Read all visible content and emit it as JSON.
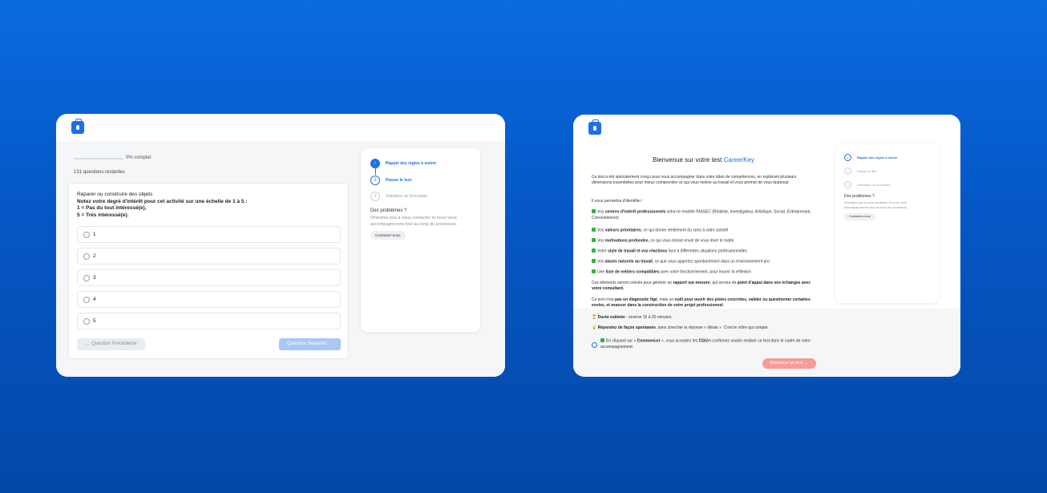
{
  "left": {
    "progress_label": "0% complet",
    "remaining": "131 questions restantes",
    "question": {
      "title": "Réparer ou construire des objets",
      "instruction": "Notez votre degré d'intérêt pour cet activité sur une échelle de 1 à 5 :",
      "scale_low": "1 = Pas du tout intéressé(e),",
      "scale_high": "5 = Très intéressé(e).",
      "options": [
        "1",
        "2",
        "3",
        "4",
        "5"
      ]
    },
    "prev_button": "← Question Précédente",
    "next_button": "Question Suivante →",
    "steps": [
      {
        "label": "Rappel des règles à suivre",
        "state": "done",
        "number": "✓"
      },
      {
        "label": "Passer le test",
        "state": "active",
        "number": "2"
      },
      {
        "label": "Validation du formulaire",
        "state": "todo",
        "number": "3"
      }
    ],
    "help_title": "Des problèmes ?",
    "help_text": "N'hésitez pas à nous contacter et nous vous accompagnerons tout au long du processus.",
    "help_button": "Contactez-nous"
  },
  "right": {
    "welcome_prefix": "Bienvenue sur votre test",
    "brand": "CareerKey",
    "intro": "Ce test a été spécialement conçu pour vous accompagner dans votre bilan de compétences, en explorant plusieurs dimensions essentielles pour mieux comprendre ce qui vous motive au travail et vous permet de vous épanouir.",
    "allows": "Il vous permettra d'identifier :",
    "items": [
      {
        "pre": "Vos ",
        "bold": "centres d'intérêt professionnels",
        "post": " selon le modèle RIASEC (Réaliste, Investigateur, Artistique, Social, Entreprenant, Conventionnel)"
      },
      {
        "pre": "Vos ",
        "bold": "valeurs prioritaires",
        "post": ", ce qui donne réellement du sens à votre activité"
      },
      {
        "pre": "Vos ",
        "bold": "motivations profondes",
        "post": ", ce qui vous donne envie de vous lever le matin"
      },
      {
        "pre": "Votre ",
        "bold": "style de travail et vos réactions",
        "post": " face à différentes situations professionnelles"
      },
      {
        "pre": "Vos ",
        "bold": "atouts naturels au travail",
        "post": ", ce que vous apportez spontanément dans un environnement pro"
      },
      {
        "pre": "Une ",
        "bold": "liste de métiers compatibles",
        "post": " avec votre fonctionnement, pour nourrir la réflexion"
      }
    ],
    "cross_pre": "Ces éléments seront croisés pour générer un ",
    "cross_bold1": "rapport sur-mesure",
    "cross_mid": ", qui servira de ",
    "cross_bold2": "point d'appui dans vos échanges avec votre consultant.",
    "diag_pre": "Ce test n'est ",
    "diag_bold1": "pas un diagnostic figé",
    "diag_mid": ", mais un ",
    "diag_bold2": "outil pour ouvrir des pistes concrètes, valider ou questionner certaines envies, et avancer dans la construction de votre projet professionnel.",
    "duration_icon": "⏳",
    "duration_bold": "Durée estimée",
    "duration_text": " : environ 15 à 20 minutes.",
    "spont_icon": "💡",
    "spont_bold": "Répondez de façon spontanée",
    "spont_text": ", sans chercher la réponse « idéale ». C'est le vôtre qui compte.",
    "consent_pre": "En cliquant sur « ",
    "consent_bold1": "Commencer",
    "consent_mid": " », vous acceptez les ",
    "consent_bold2": "CGU",
    "consent_post": "et confirmez vouloir réaliser ce test dans le cadre de votre accompagnement.",
    "start_button": "Démarrer un test →",
    "steps": [
      {
        "label": "Rappel des règles à suivre",
        "state": "active",
        "number": "1"
      },
      {
        "label": "Passer le test",
        "state": "todo",
        "number": "2"
      },
      {
        "label": "Validation du formulaire",
        "state": "todo",
        "number": "3"
      }
    ],
    "help_title": "Des problèmes ?",
    "help_text": "N'hésitez pas à nous contacter et nous vous accompagnerons tout au long du processus.",
    "help_button": "Contactez-nous"
  },
  "colors": {
    "accent": "#1f6fe6",
    "start_button": "#f59c97",
    "next_button": "#a9c7f4",
    "check": "#2fb344"
  }
}
